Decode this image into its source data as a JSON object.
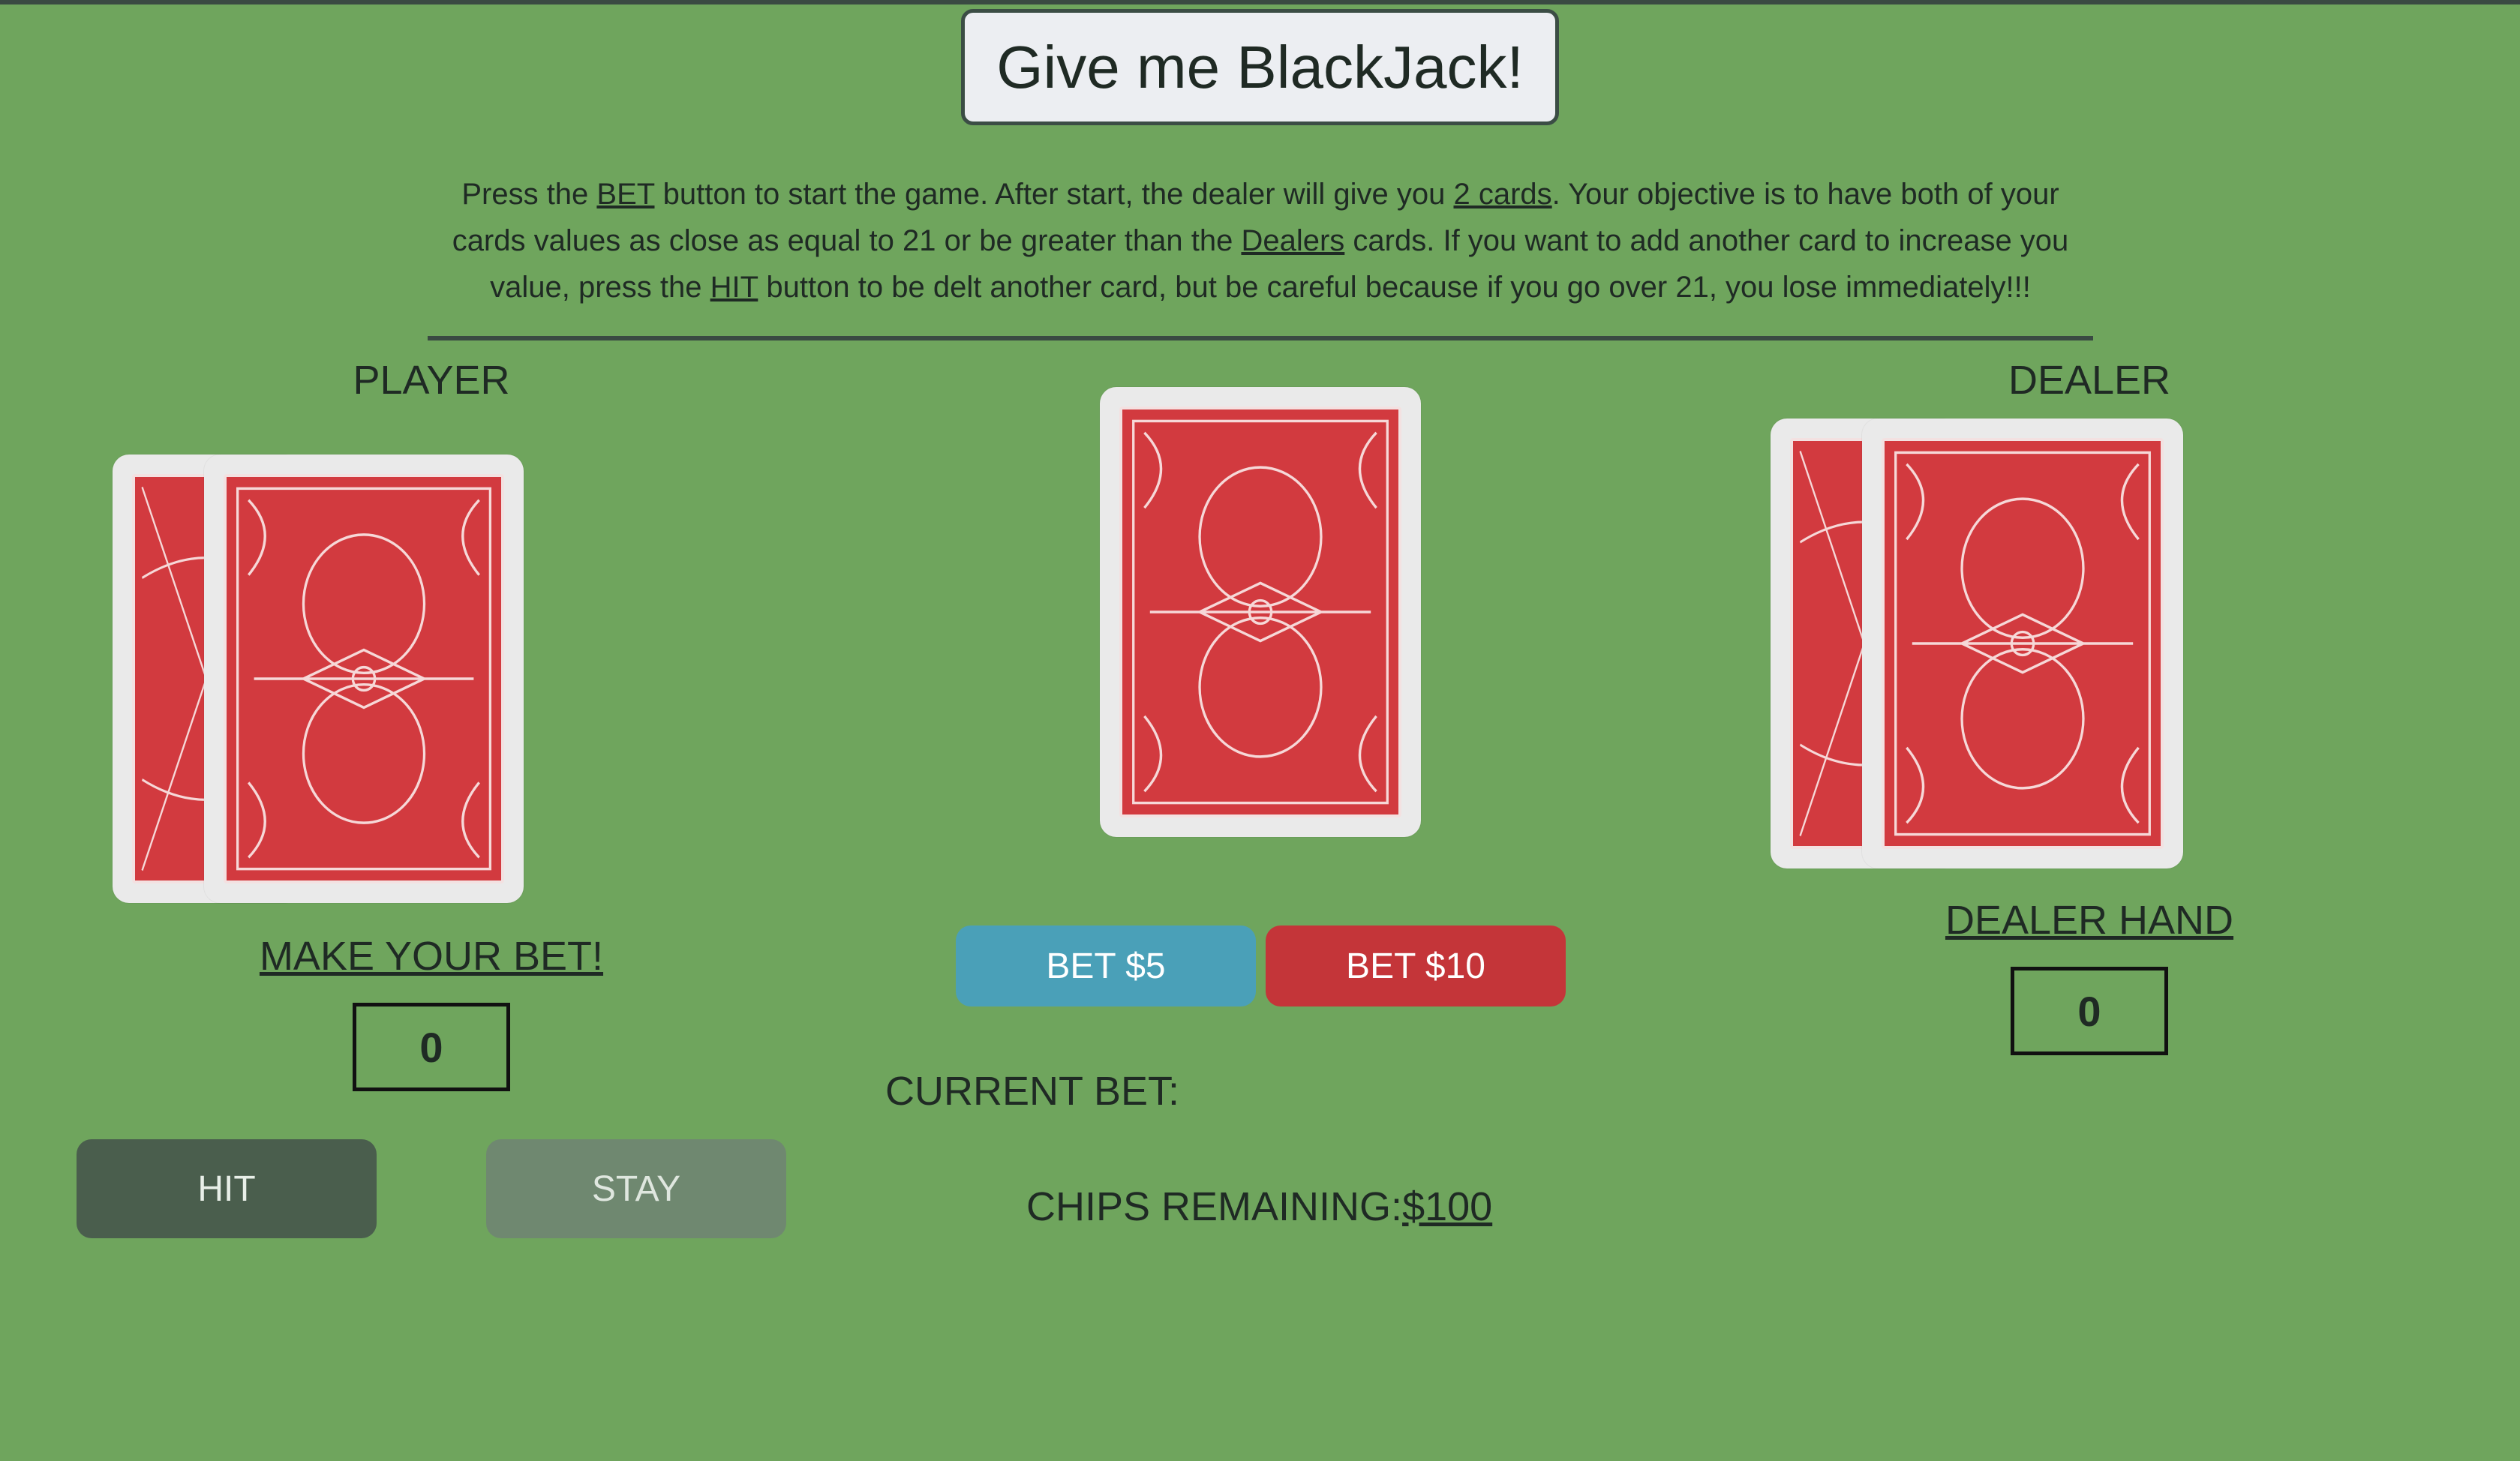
{
  "title": "Give me BlackJack!",
  "instructions": {
    "p1": "Press the ",
    "bet_word": "BET",
    "p2": " button to start the game. After start, the dealer will give you ",
    "cards_word": "2 cards",
    "p3": ". Your objective is to have both of your cards values as close as equal to 21 or be greater than the ",
    "dealers_word": "Dealers",
    "p4": " cards. If you want to add another card to increase you value, press the ",
    "hit_word": "HIT",
    "p5": " button to be delt another card, but be careful because if you go over 21, you lose immediately!!!"
  },
  "player": {
    "heading": "PLAYER",
    "prompt": "MAKE YOUR BET!",
    "score": "0",
    "hit_label": "HIT",
    "stay_label": "STAY",
    "card_count": 2
  },
  "dealer": {
    "heading": "DEALER",
    "hand_label": "DEALER HAND",
    "score": "0",
    "card_count": 2
  },
  "deck": {
    "card_count": 1
  },
  "betting": {
    "bet5_label": "BET $5",
    "bet10_label": "BET $10",
    "current_bet_label": "CURRENT BET:",
    "current_bet_value": "",
    "chips_label": "CHIPS REMAINING:",
    "chips_value": "$100"
  },
  "colors": {
    "background": "#6fa55d",
    "bet5": "#4aa0b8",
    "bet10": "#c43539",
    "hit": "#4a5e4d",
    "stay": "#6f8870",
    "card_back": "#d23a3f"
  }
}
